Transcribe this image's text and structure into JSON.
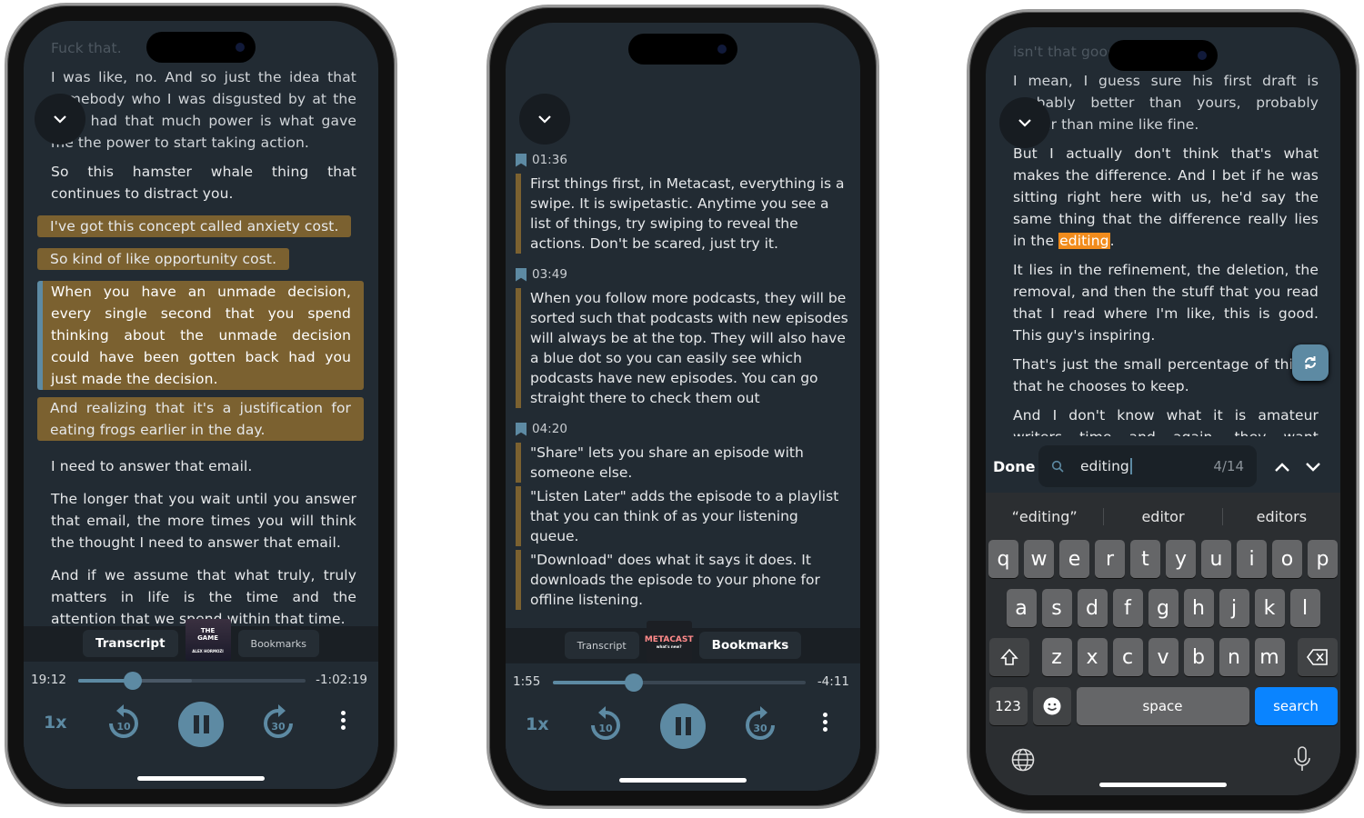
{
  "phone1": {
    "faded_top": "Fuck that.",
    "paragraphs_before": [
      "I was like, no. And so just the idea that somebody who I was disgusted by at the time had that much power is what gave me the power to start taking action.",
      "So this hamster whale thing that continues to distract you."
    ],
    "highlights_inline": [
      "I've got this concept called anxiety cost.",
      "So kind of like opportunity cost."
    ],
    "current_highlight": "When you have an unmade decision, every single second that you spend thinking about the unmade decision could have been gotten back had you just made the decision.",
    "highlight_after": "And realizing that it's a justification for eating frogs earlier in the day.",
    "paragraphs_after": [
      "I need to answer that email.",
      "The longer that you wait until you answer that email, the more times you will think the thought I need to answer that email.",
      "And if we assume that what truly, truly matters in life is the time and the attention that we spend within that time."
    ],
    "tabs": {
      "transcript": "Transcript",
      "bookmarks": "Bookmarks",
      "active": "transcript"
    },
    "artwork": {
      "title": "THE GAME",
      "author": "ALEX HORMOZI"
    },
    "player": {
      "elapsed": "19:12",
      "remaining": "-1:02:19",
      "progress_percent": 24,
      "speed": "1x",
      "skip_back": "10",
      "skip_forward": "30",
      "state": "playing"
    }
  },
  "phone2": {
    "bookmarks": [
      {
        "time": "01:36",
        "texts": [
          "First things first, in Metacast, everything is a swipe. It is swipetastic. Anytime you see a list of things, try swiping to reveal the actions. Don't be scared, just try it."
        ]
      },
      {
        "time": "03:49",
        "texts": [
          "When you follow more podcasts, they will be sorted such that podcasts with new episodes will always be at the top. They will also have a blue dot so you can easily see which podcasts have new episodes. You can go straight there to check them out"
        ]
      },
      {
        "time": "04:20",
        "texts": [
          "\"Share\" lets you share an episode with someone else.",
          "\"Listen Later\" adds the episode to a playlist that you can think of as your listening queue.",
          "\"Download\" does what it says it does. It downloads the episode to your phone for offline listening."
        ]
      }
    ],
    "tabs": {
      "transcript": "Transcript",
      "bookmarks": "Bookmarks",
      "active": "bookmarks"
    },
    "artwork": {
      "title": "METACAST",
      "subtitle": "what's new?"
    },
    "player": {
      "elapsed": "1:55",
      "remaining": "-4:11",
      "progress_percent": 32,
      "speed": "1x",
      "skip_back": "10",
      "skip_forward": "30",
      "state": "playing"
    }
  },
  "phone3": {
    "faded_top": "isn't that good",
    "p1": "I mean, I guess sure his first draft is probably better than yours, probably better than mine like fine.",
    "p2_before": "But I actually don't think that's what makes the difference. And I bet if he was sitting right here with us, he'd say the same thing that the difference really lies in the ",
    "p2_match": "editing",
    "p2_after": ".",
    "p3": "It lies in the refinement, the deletion, the removal, and then the stuff that you read that I read where I'm like, this is good. This guy's inspiring.",
    "p4": "That's just the small percentage of things that he chooses to keep.",
    "p5": "And I don't know what it is amateur writers time and again, they want everything that they write to be great. They're like, I'm a",
    "highlight_color": "#f28c1c",
    "search": {
      "done": "Done",
      "query": "editing",
      "count": "4/14"
    },
    "suggestions": [
      "“editing”",
      "editor",
      "editors"
    ],
    "keyboard": {
      "row1": [
        "q",
        "w",
        "e",
        "r",
        "t",
        "y",
        "u",
        "i",
        "o",
        "p"
      ],
      "row2": [
        "a",
        "s",
        "d",
        "f",
        "g",
        "h",
        "j",
        "k",
        "l"
      ],
      "row3": [
        "z",
        "x",
        "c",
        "v",
        "b",
        "n",
        "m"
      ],
      "numbers": "123",
      "space": "space",
      "search": "search"
    }
  }
}
